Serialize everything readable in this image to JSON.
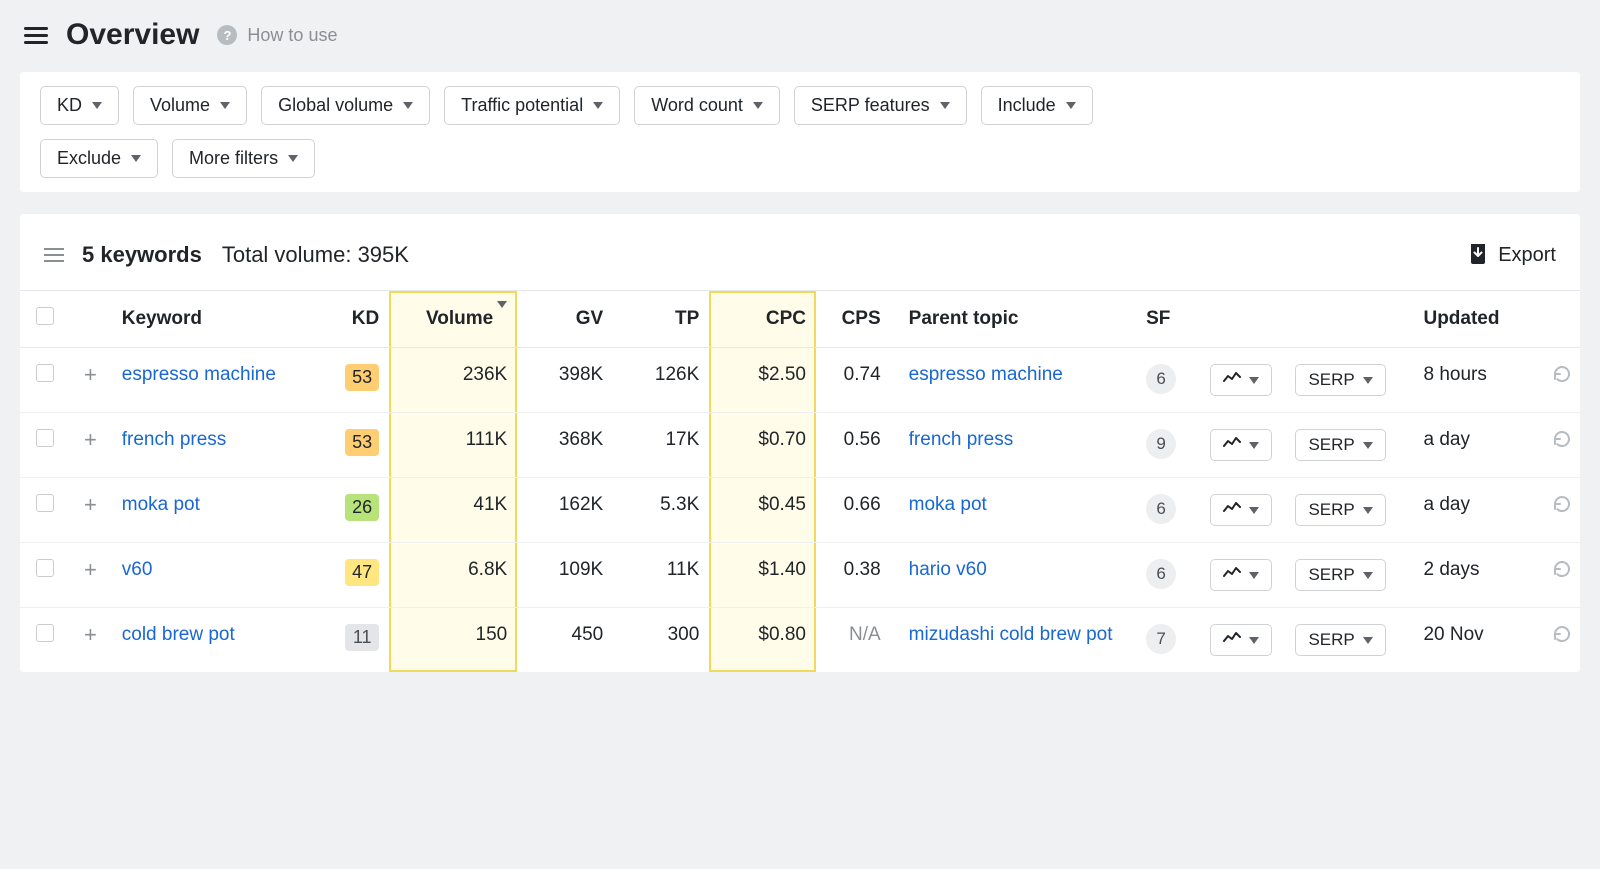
{
  "header": {
    "title": "Overview",
    "help_label": "How to use"
  },
  "filters": {
    "row1": [
      "KD",
      "Volume",
      "Global volume",
      "Traffic potential",
      "Word count",
      "SERP features",
      "Include"
    ],
    "row2": [
      "Exclude",
      "More filters"
    ]
  },
  "summary": {
    "keyword_count_label": "5 keywords",
    "total_volume_label": "Total volume: 395K",
    "export_label": "Export"
  },
  "columns": {
    "keyword": "Keyword",
    "kd": "KD",
    "volume": "Volume",
    "gv": "GV",
    "tp": "TP",
    "cpc": "CPC",
    "cps": "CPS",
    "parent": "Parent topic",
    "sf": "SF",
    "serp_btn": "SERP",
    "updated": "Updated"
  },
  "rows": [
    {
      "keyword": "espresso machine",
      "kd": "53",
      "kd_class": "kd-orange",
      "volume": "236K",
      "gv": "398K",
      "tp": "126K",
      "cpc": "$2.50",
      "cps": "0.74",
      "parent": "espresso machine",
      "sf": "6",
      "updated": "8 hours"
    },
    {
      "keyword": "french press",
      "kd": "53",
      "kd_class": "kd-orange",
      "volume": "111K",
      "gv": "368K",
      "tp": "17K",
      "cpc": "$0.70",
      "cps": "0.56",
      "parent": "french press",
      "sf": "9",
      "updated": "a day"
    },
    {
      "keyword": "moka pot",
      "kd": "26",
      "kd_class": "kd-green",
      "volume": "41K",
      "gv": "162K",
      "tp": "5.3K",
      "cpc": "$0.45",
      "cps": "0.66",
      "parent": "moka pot",
      "sf": "6",
      "updated": "a day"
    },
    {
      "keyword": "v60",
      "kd": "47",
      "kd_class": "kd-yellow",
      "volume": "6.8K",
      "gv": "109K",
      "tp": "11K",
      "cpc": "$1.40",
      "cps": "0.38",
      "parent": "hario v60",
      "sf": "6",
      "updated": "2 days"
    },
    {
      "keyword": "cold brew pot",
      "kd": "11",
      "kd_class": "kd-grey",
      "volume": "150",
      "gv": "450",
      "tp": "300",
      "cpc": "$0.80",
      "cps": "N/A",
      "parent": "mizudashi cold brew pot",
      "sf": "7",
      "updated": "20 Nov"
    }
  ]
}
